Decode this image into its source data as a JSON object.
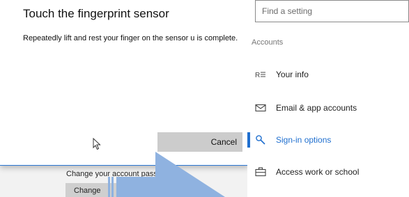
{
  "dialog": {
    "title": "Touch the fingerprint sensor",
    "description": "Repeatedly lift and rest your finger on the sensor u is complete.",
    "cancel_label": "Cancel"
  },
  "behind": {
    "change_password_text": "Change your account passwd",
    "change_button_label": "Change"
  },
  "settings_pane": {
    "search_placeholder": "Find a setting",
    "group_label": "Accounts",
    "items": [
      {
        "label": "Your info",
        "icon": "person-card-icon",
        "active": false
      },
      {
        "label": "Email & app accounts",
        "icon": "mail-icon",
        "active": false
      },
      {
        "label": "Sign-in options",
        "icon": "key-icon",
        "active": true
      },
      {
        "label": "Access work or school",
        "icon": "briefcase-icon",
        "active": false
      }
    ]
  },
  "colors": {
    "accent": "#1f6fcf",
    "overlay_arrow": "#8fb2e0"
  }
}
